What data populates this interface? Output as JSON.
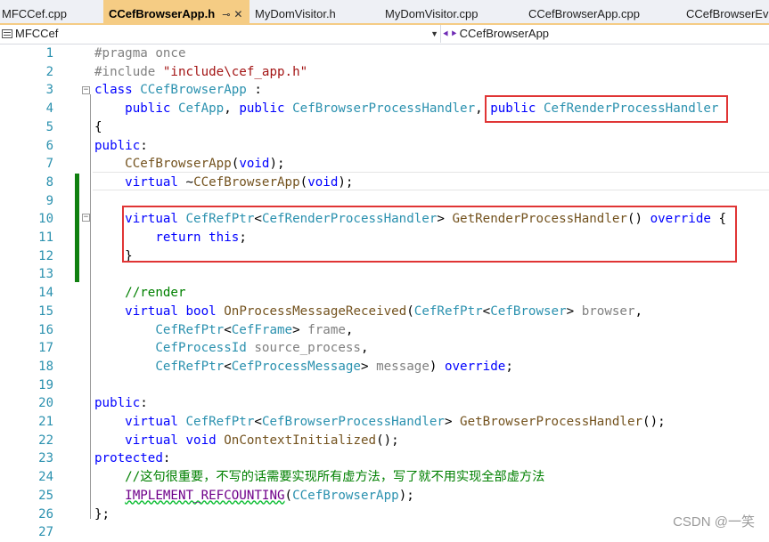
{
  "tabs": [
    {
      "label": "MFCCef.cpp"
    },
    {
      "label": "CCefBrowserApp.h",
      "active": true
    },
    {
      "label": "MyDomVisitor.h"
    },
    {
      "label": "MyDomVisitor.cpp"
    },
    {
      "label": "CCefBrowserApp.cpp"
    },
    {
      "label": "CCefBrowserEve"
    }
  ],
  "tab_icons": {
    "pin": "pin-icon",
    "close": "close-icon"
  },
  "navbar": {
    "project": "MFCCef",
    "scope": "CCefBrowserApp",
    "project_icon": "project-icon",
    "scope_icon": "class-icon"
  },
  "code_lines": [
    {
      "n": "1",
      "tokens": [
        [
          "pp",
          "#pragma once"
        ]
      ]
    },
    {
      "n": "2",
      "tokens": [
        [
          "pp",
          "#include "
        ],
        [
          "str",
          "\"include\\cef_app.h\""
        ]
      ]
    },
    {
      "n": "3",
      "tokens": [
        [
          "kw",
          "class "
        ],
        [
          "ty",
          "CCefBrowserApp"
        ],
        [
          "plain",
          " :"
        ]
      ]
    },
    {
      "n": "4",
      "tokens": [
        [
          "plain",
          "    "
        ],
        [
          "kw",
          "public "
        ],
        [
          "ty",
          "CefApp"
        ],
        [
          "plain",
          ", "
        ],
        [
          "kw",
          "public "
        ],
        [
          "ty",
          "CefBrowserProcessHandler"
        ],
        [
          "plain",
          ", "
        ],
        [
          "kw",
          "public "
        ],
        [
          "ty",
          "CefRenderProcessHandler"
        ]
      ]
    },
    {
      "n": "5",
      "tokens": [
        [
          "plain",
          "{"
        ]
      ]
    },
    {
      "n": "6",
      "tokens": [
        [
          "kw",
          "public"
        ],
        [
          "plain",
          ":"
        ]
      ]
    },
    {
      "n": "7",
      "tokens": [
        [
          "plain",
          "    "
        ],
        [
          "fn",
          "CCefBrowserApp"
        ],
        [
          "plain",
          "("
        ],
        [
          "kw",
          "void"
        ],
        [
          "plain",
          ");"
        ]
      ]
    },
    {
      "n": "8",
      "tokens": [
        [
          "plain",
          "    "
        ],
        [
          "kw",
          "virtual "
        ],
        [
          "plain",
          "~"
        ],
        [
          "fn",
          "CCefBrowserApp"
        ],
        [
          "plain",
          "("
        ],
        [
          "kw",
          "void"
        ],
        [
          "plain",
          ");"
        ]
      ]
    },
    {
      "n": "9",
      "tokens": []
    },
    {
      "n": "10",
      "tokens": [
        [
          "plain",
          "    "
        ],
        [
          "kw",
          "virtual "
        ],
        [
          "ty",
          "CefRefPtr"
        ],
        [
          "plain",
          "<"
        ],
        [
          "ty",
          "CefRenderProcessHandler"
        ],
        [
          "plain",
          "> "
        ],
        [
          "fn",
          "GetRenderProcessHandler"
        ],
        [
          "plain",
          "() "
        ],
        [
          "kw",
          "override"
        ],
        [
          "plain",
          " {"
        ]
      ]
    },
    {
      "n": "11",
      "tokens": [
        [
          "plain",
          "        "
        ],
        [
          "kw",
          "return "
        ],
        [
          "kw",
          "this"
        ],
        [
          "plain",
          ";"
        ]
      ]
    },
    {
      "n": "12",
      "tokens": [
        [
          "plain",
          "    }"
        ]
      ]
    },
    {
      "n": "13",
      "tokens": []
    },
    {
      "n": "14",
      "tokens": [
        [
          "plain",
          "    "
        ],
        [
          "cm",
          "//render"
        ]
      ]
    },
    {
      "n": "15",
      "tokens": [
        [
          "plain",
          "    "
        ],
        [
          "kw",
          "virtual "
        ],
        [
          "kw",
          "bool "
        ],
        [
          "fn",
          "OnProcessMessageReceived"
        ],
        [
          "plain",
          "("
        ],
        [
          "ty",
          "CefRefPtr"
        ],
        [
          "plain",
          "<"
        ],
        [
          "ty",
          "CefBrowser"
        ],
        [
          "plain",
          "> "
        ],
        [
          "prm",
          "browser"
        ],
        [
          "plain",
          ","
        ]
      ]
    },
    {
      "n": "16",
      "tokens": [
        [
          "plain",
          "        "
        ],
        [
          "ty",
          "CefRefPtr"
        ],
        [
          "plain",
          "<"
        ],
        [
          "ty",
          "CefFrame"
        ],
        [
          "plain",
          "> "
        ],
        [
          "prm",
          "frame"
        ],
        [
          "plain",
          ","
        ]
      ]
    },
    {
      "n": "17",
      "tokens": [
        [
          "plain",
          "        "
        ],
        [
          "ty",
          "CefProcessId "
        ],
        [
          "prm",
          "source_process"
        ],
        [
          "plain",
          ","
        ]
      ]
    },
    {
      "n": "18",
      "tokens": [
        [
          "plain",
          "        "
        ],
        [
          "ty",
          "CefRefPtr"
        ],
        [
          "plain",
          "<"
        ],
        [
          "ty",
          "CefProcessMessage"
        ],
        [
          "plain",
          "> "
        ],
        [
          "prm",
          "message"
        ],
        [
          "plain",
          ") "
        ],
        [
          "kw",
          "override"
        ],
        [
          "plain",
          ";"
        ]
      ]
    },
    {
      "n": "19",
      "tokens": []
    },
    {
      "n": "20",
      "tokens": [
        [
          "kw",
          "public"
        ],
        [
          "plain",
          ":"
        ]
      ]
    },
    {
      "n": "21",
      "tokens": [
        [
          "plain",
          "    "
        ],
        [
          "kw",
          "virtual "
        ],
        [
          "ty",
          "CefRefPtr"
        ],
        [
          "plain",
          "<"
        ],
        [
          "ty",
          "CefBrowserProcessHandler"
        ],
        [
          "plain",
          "> "
        ],
        [
          "fn",
          "GetBrowserProcessHandler"
        ],
        [
          "plain",
          "();"
        ]
      ]
    },
    {
      "n": "22",
      "tokens": [
        [
          "plain",
          "    "
        ],
        [
          "kw",
          "virtual "
        ],
        [
          "kw",
          "void "
        ],
        [
          "fn",
          "OnContextInitialized"
        ],
        [
          "plain",
          "();"
        ]
      ]
    },
    {
      "n": "23",
      "tokens": [
        [
          "kw",
          "protected"
        ],
        [
          "plain",
          ":"
        ]
      ]
    },
    {
      "n": "24",
      "tokens": [
        [
          "plain",
          "    "
        ],
        [
          "cm",
          "//这句很重要，不写的话需要实现所有虚方法，写了就不用实现全部虚方法"
        ]
      ]
    },
    {
      "n": "25",
      "tokens": [
        [
          "plain",
          "    "
        ],
        [
          "mac squig",
          "IMPLEMENT_REFCOUNTING"
        ],
        [
          "plain",
          "("
        ],
        [
          "ty",
          "CCefBrowserApp"
        ],
        [
          "plain",
          ");"
        ]
      ]
    },
    {
      "n": "26",
      "tokens": [
        [
          "plain",
          "};"
        ]
      ]
    },
    {
      "n": "27",
      "tokens": []
    }
  ],
  "watermark": "CSDN @一笑",
  "colors": {
    "active_tab": "#f5cc84",
    "keyword": "#0000ff",
    "type": "#2b91af",
    "string": "#a31515",
    "comment": "#008000",
    "macro": "#6f008a",
    "highlight_box": "#e03535",
    "change_bar": "#108010"
  }
}
